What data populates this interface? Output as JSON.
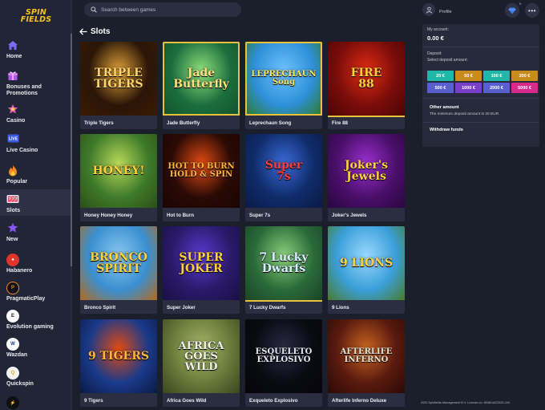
{
  "brand": {
    "logo_line1": "SPIN",
    "logo_line2": "FIELDS"
  },
  "search": {
    "placeholder": "Search between games"
  },
  "nav": [
    {
      "label": "Home",
      "icon": "home-icon"
    },
    {
      "label": "Bonuses and Promotions",
      "icon": "gift-icon"
    },
    {
      "label": "Casino",
      "icon": "casino-icon"
    },
    {
      "label": "Live Casino",
      "icon": "live-icon"
    },
    {
      "label": "Popular",
      "icon": "flame-icon"
    },
    {
      "label": "Slots",
      "icon": "slots-icon",
      "active": true
    },
    {
      "label": "New",
      "icon": "star-icon"
    }
  ],
  "providers": [
    {
      "label": "Habanero"
    },
    {
      "label": "PragmaticPlay"
    },
    {
      "label": "Evolution gaming"
    },
    {
      "label": "Wazdan"
    },
    {
      "label": "Quickspin"
    }
  ],
  "page": {
    "title": "Slots"
  },
  "games": [
    {
      "name": "Triple Tigers",
      "art": "TRIPLE\nTIGERS",
      "bg": "#2a1506",
      "c1": "#e2a33a",
      "c2": "#3b1a05",
      "tc": "#ffd36b"
    },
    {
      "name": "Jade Butterfly",
      "art": "Jade\nButterfly",
      "bg": "#1b6d3e",
      "c1": "#8fe07a",
      "c2": "#12512c",
      "tc": "#ffe27d"
    },
    {
      "name": "Leprechaun Song",
      "art": "LEPRECHAUN\nSong",
      "bg": "#2f8fd8",
      "c1": "#6cc3ff",
      "c2": "#2d7a22",
      "tc": "#ffe35a"
    },
    {
      "name": "Fire 88",
      "art": "FIRE\n88",
      "bg": "#7a0d0a",
      "c1": "#e22b12",
      "c2": "#4a0505",
      "tc": "#ffd23d"
    },
    {
      "name": "Honey Honey Honey",
      "art": "HONEY!",
      "bg": "#3f7a2a",
      "c1": "#b7d95a",
      "c2": "#2b4f18",
      "tc": "#ffce3a"
    },
    {
      "name": "Hot to Burn",
      "art": "HOT TO BURN\nHOLD & SPIN",
      "bg": "#2a0a05",
      "c1": "#e24a12",
      "c2": "#1a0503",
      "tc": "#ffb53a"
    },
    {
      "name": "Super 7s",
      "art": "Super\n7s",
      "bg": "#0f2c6a",
      "c1": "#3b6ad8",
      "c2": "#0a1a45",
      "tc": "#ff3b3b"
    },
    {
      "name": "Joker's Jewels",
      "art": "Joker's\nJewels",
      "bg": "#4a0f6a",
      "c1": "#9b2fd0",
      "c2": "#2a0640",
      "tc": "#ffd23d"
    },
    {
      "name": "Bronco Spirit",
      "art": "BRONCO\nSPIRIT",
      "bg": "#3a8fd0",
      "c1": "#8ac8f0",
      "c2": "#b36a1c",
      "tc": "#ffd23d"
    },
    {
      "name": "Super Joker",
      "art": "SUPER\nJOKER",
      "bg": "#2a1a6a",
      "c1": "#5a3ad0",
      "c2": "#1a0f45",
      "tc": "#ffcf3a"
    },
    {
      "name": "7 Lucky Dwarfs",
      "art": "7 Lucky\nDwarfs",
      "bg": "#2a6a3a",
      "c1": "#8ad07a",
      "c2": "#1a4525",
      "tc": "#d8f0ff"
    },
    {
      "name": "9 Lions",
      "art": "9 LIONS",
      "bg": "#3a9fd8",
      "c1": "#9ad8ff",
      "c2": "#4a7a2a",
      "tc": "#ffd23d"
    },
    {
      "name": "9 Tigers",
      "art": "9 TIGERS",
      "bg": "#1a3a8a",
      "c1": "#e24a12",
      "c2": "#0a1a45",
      "tc": "#ffb53a"
    },
    {
      "name": "Africa Goes Wild",
      "art": "AFRICA\nGOES\nWILD",
      "bg": "#6a7a3a",
      "c1": "#a8b86a",
      "c2": "#3a4520",
      "tc": "#f0f0e8"
    },
    {
      "name": "Exqueleto Explosivo",
      "art": "ESQUELETO\nEXPLOSIVO",
      "bg": "#0a0a12",
      "c1": "#2a2a45",
      "c2": "#05050a",
      "tc": "#e8e8f0"
    },
    {
      "name": "Afterlife Inferno Deluxe",
      "art": "AFTERLIFE\nINFERNO",
      "bg": "#5a1a0f",
      "c1": "#c8651f",
      "c2": "#2a0a05",
      "tc": "#e8e0d0"
    }
  ],
  "account": {
    "profile_label": "Profile",
    "notif_count": "0",
    "my_account_label": "My account:",
    "balance": "0.00 €",
    "deposit_label": "Deposit:",
    "select_label": "Select deposit amount:",
    "amounts": [
      {
        "label": "20 €",
        "color": "#1fb8a8"
      },
      {
        "label": "50 €",
        "color": "#c98b1c"
      },
      {
        "label": "100 €",
        "color": "#1fb8a8"
      },
      {
        "label": "200 €",
        "color": "#c98b1c"
      },
      {
        "label": "500 €",
        "color": "#5a5fd0"
      },
      {
        "label": "1000 €",
        "color": "#7a3fc8"
      },
      {
        "label": "2000 €",
        "color": "#5a5fd0"
      },
      {
        "label": "5000 €",
        "color": "#d82a8a"
      }
    ],
    "other_amount_label": "Other amount",
    "minimum_note": "The minimum deposit amount is 20 EUR",
    "withdraw_label": "Withdraw funds"
  },
  "footer": {
    "copyright": "2020 Spinfields Management B.V. License no. 8048/JAZ2020-040."
  }
}
